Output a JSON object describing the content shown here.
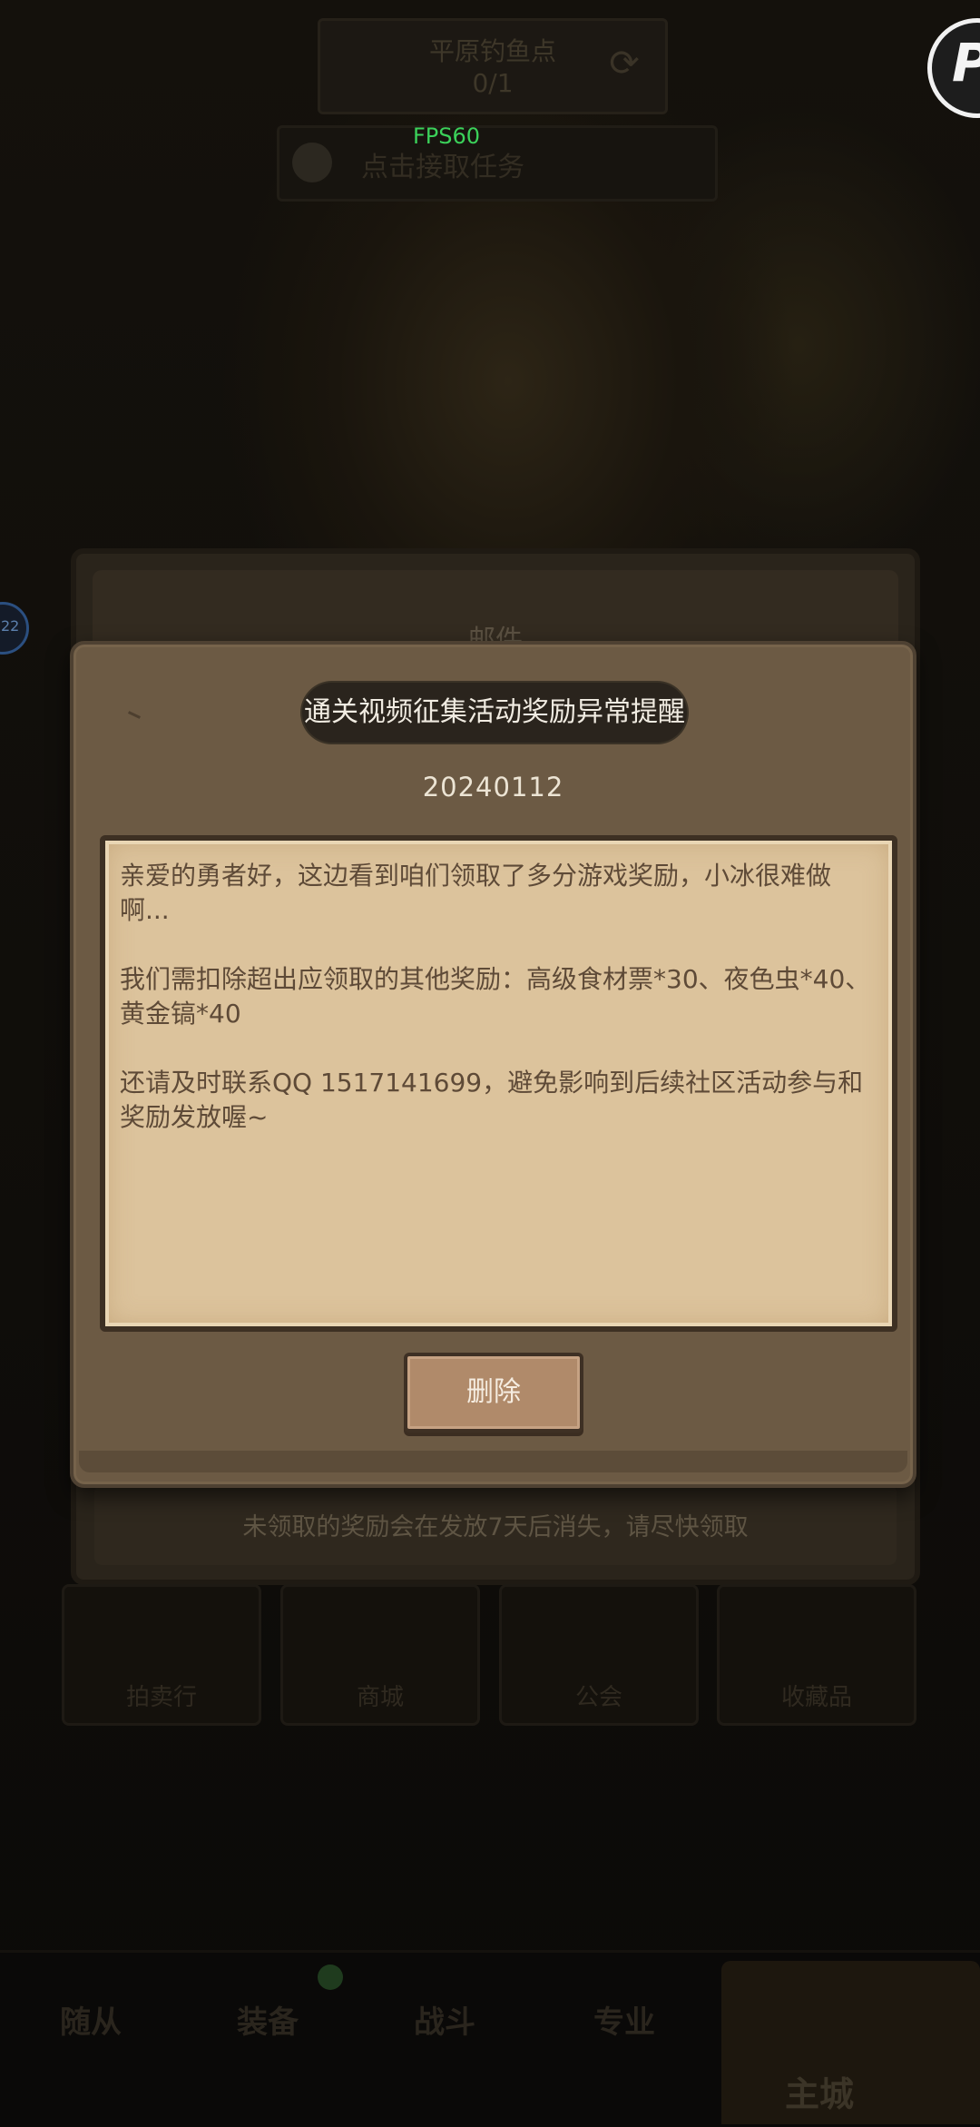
{
  "background": {
    "fishing_panel": {
      "title": "平原钓鱼点",
      "count": "0/1"
    },
    "task_bar": {
      "label": "点击接取任务"
    },
    "fps": "FPS60",
    "badge_letter": "P",
    "left_badge": "22",
    "mail_panel": {
      "title": "邮件",
      "notice": "未领取的奖励会在发放7天后消失，请尽快领取"
    },
    "feature_tiles": [
      "拍卖行",
      "商城",
      "公会",
      "收藏品"
    ],
    "bottom_nav": [
      "随从",
      "装备",
      "战斗",
      "专业",
      "主城"
    ]
  },
  "mail_detail": {
    "title": "通关视频征集活动奖励异常提醒",
    "date": "20240112",
    "body": "亲爱的勇者好，这边看到咱们领取了多分游戏奖励，小冰很难做啊...\n\n我们需扣除超出应领取的其他奖励：高级食材票*30、夜色虫*40、黄金镐*40\n\n还请及时联系QQ 1517141699，避免影响到后续社区活动参与和奖励发放喔~",
    "delete_button": "删除"
  }
}
